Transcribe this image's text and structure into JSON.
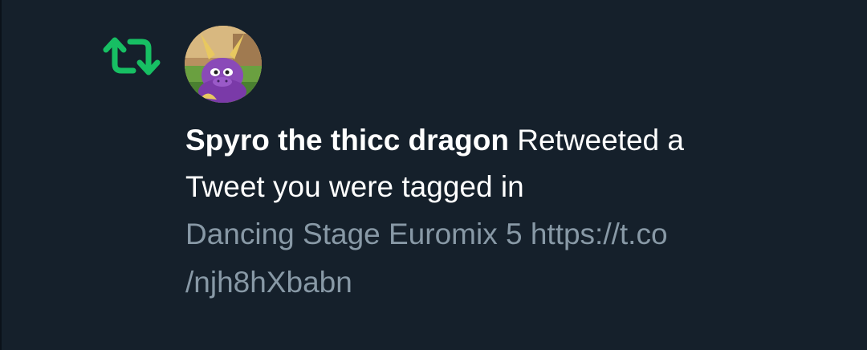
{
  "notification": {
    "icon": "retweet-icon",
    "accent_color": "#17bf63",
    "avatar": {
      "description_icon": "spyro-dragon-avatar"
    },
    "user_name": "Spyro the thicc dragon",
    "action_text_line1": " Retweeted a",
    "action_text_line2": "Tweet you were tagged in",
    "tweet_text_line1": "Dancing Stage Euromix 5 https://t.co",
    "tweet_text_line2": "/njh8hXbabn"
  }
}
